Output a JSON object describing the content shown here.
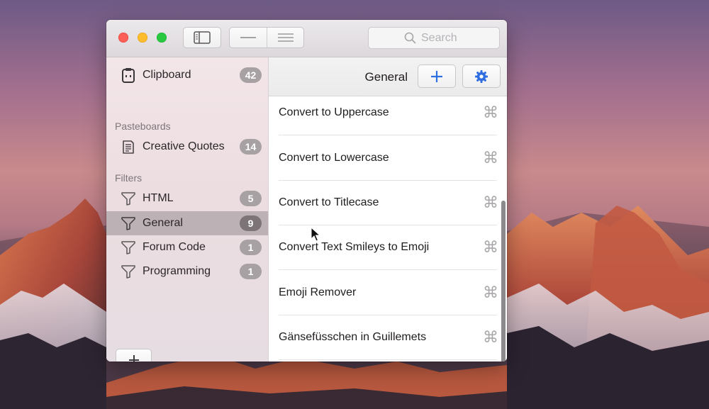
{
  "window": {
    "search_placeholder": "Search"
  },
  "sidebar": {
    "items": [
      {
        "label": "Clipboard",
        "count": "42",
        "icon": "clipboard-icon"
      },
      {
        "label": "Creative Quotes",
        "count": "14",
        "icon": "document-icon"
      },
      {
        "label": "HTML",
        "count": "5",
        "icon": "funnel-icon"
      },
      {
        "label": "General",
        "count": "9",
        "icon": "funnel-icon",
        "selected": true
      },
      {
        "label": "Forum Code",
        "count": "1",
        "icon": "funnel-icon"
      },
      {
        "label": "Programming",
        "count": "1",
        "icon": "funnel-icon"
      }
    ],
    "section_pasteboards": "Pasteboards",
    "section_filters": "Filters"
  },
  "main": {
    "title": "General",
    "rows": [
      {
        "label": "Convert to Uppercase",
        "shortcut": "⌘"
      },
      {
        "label": "Convert to Lowercase",
        "shortcut": "⌘"
      },
      {
        "label": "Convert to Titlecase",
        "shortcut": "⌘"
      },
      {
        "label": "Convert Text Smileys to Emoji",
        "shortcut": "⌘"
      },
      {
        "label": "Emoji Remover",
        "shortcut": "⌘"
      },
      {
        "label": "Gänsefüsschen in Guillemets",
        "shortcut": "⌘"
      }
    ]
  },
  "colors": {
    "accent": "#2f6fe0",
    "selected_row": "#bcb2b6"
  }
}
